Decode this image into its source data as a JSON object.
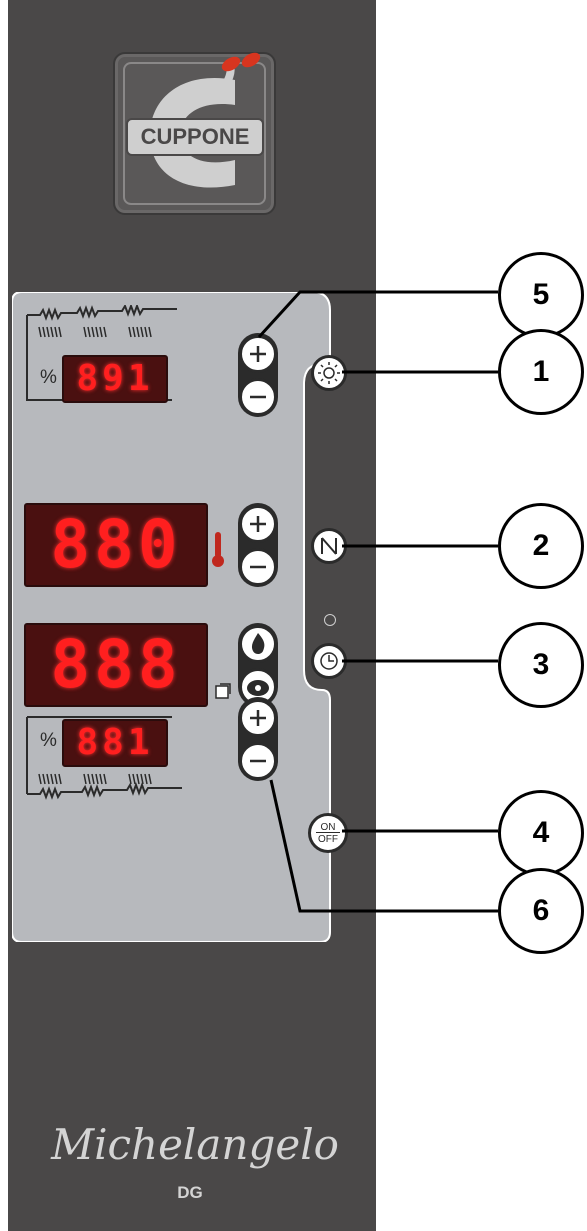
{
  "brand": {
    "logo_text": "CUPPONE",
    "model": "Michelangelo",
    "variant": "DG"
  },
  "colors": {
    "panel": "#4a4848",
    "plate": "#b7b9bd",
    "led": "#ff1f1f",
    "accent_leaf": "#d8351f"
  },
  "top_section": {
    "percent_label": "%",
    "display": "891"
  },
  "temp_display": "880",
  "timer_display": "888",
  "bottom_section": {
    "percent_label": "%",
    "display": "881"
  },
  "icons": {
    "light": "light-bulb-icon",
    "steam": "steam-valve-icon",
    "timer": "clock-icon",
    "flame": "flame-icon",
    "eco": "piggy-bank-icon",
    "thermo": "thermometer-icon",
    "program": "program-icon"
  },
  "power_button": {
    "top": "ON",
    "bottom": "OFF"
  },
  "callouts": [
    "5",
    "1",
    "2",
    "3",
    "4",
    "6"
  ]
}
